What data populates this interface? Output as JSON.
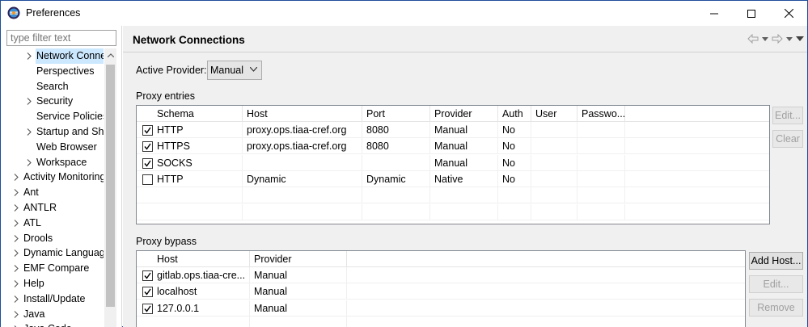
{
  "window": {
    "title": "Preferences"
  },
  "left": {
    "filter_placeholder": "type filter text",
    "tree": [
      {
        "label": "Network Conne",
        "level": 1,
        "expander": true,
        "selected": true
      },
      {
        "label": "Perspectives",
        "level": 1,
        "expander": false
      },
      {
        "label": "Search",
        "level": 1,
        "expander": false
      },
      {
        "label": "Security",
        "level": 1,
        "expander": true
      },
      {
        "label": "Service Policies",
        "level": 1,
        "expander": false
      },
      {
        "label": "Startup and Shu",
        "level": 1,
        "expander": true
      },
      {
        "label": "Web Browser",
        "level": 1,
        "expander": false
      },
      {
        "label": "Workspace",
        "level": 1,
        "expander": true
      },
      {
        "label": "Activity Monitoring",
        "level": 0,
        "expander": true
      },
      {
        "label": "Ant",
        "level": 0,
        "expander": true
      },
      {
        "label": "ANTLR",
        "level": 0,
        "expander": true
      },
      {
        "label": "ATL",
        "level": 0,
        "expander": true
      },
      {
        "label": "Drools",
        "level": 0,
        "expander": true
      },
      {
        "label": "Dynamic Languag",
        "level": 0,
        "expander": true
      },
      {
        "label": "EMF Compare",
        "level": 0,
        "expander": true
      },
      {
        "label": "Help",
        "level": 0,
        "expander": true
      },
      {
        "label": "Install/Update",
        "level": 0,
        "expander": true
      },
      {
        "label": "Java",
        "level": 0,
        "expander": true
      },
      {
        "label": "Java Code",
        "level": 0,
        "expander": true
      }
    ]
  },
  "right": {
    "title": "Network Connections",
    "active_provider_label": "Active Provider:",
    "active_provider_value": "Manual",
    "proxy_entries": {
      "label": "Proxy entries",
      "columns": [
        "Schema",
        "Host",
        "Port",
        "Provider",
        "Auth",
        "User",
        "Passwo..."
      ],
      "rows": [
        {
          "checked": true,
          "schema": "HTTP",
          "host": "proxy.ops.tiaa-cref.org",
          "port": "8080",
          "provider": "Manual",
          "auth": "No",
          "user": "",
          "password": ""
        },
        {
          "checked": true,
          "schema": "HTTPS",
          "host": "proxy.ops.tiaa-cref.org",
          "port": "8080",
          "provider": "Manual",
          "auth": "No",
          "user": "",
          "password": ""
        },
        {
          "checked": true,
          "schema": "SOCKS",
          "host": "",
          "port": "",
          "provider": "Manual",
          "auth": "No",
          "user": "",
          "password": ""
        },
        {
          "checked": false,
          "schema": "HTTP",
          "host": "Dynamic",
          "port": "Dynamic",
          "provider": "Native",
          "auth": "No",
          "user": "",
          "password": ""
        }
      ],
      "buttons": {
        "edit": "Edit...",
        "clear": "Clear"
      }
    },
    "proxy_bypass": {
      "label": "Proxy bypass",
      "columns": [
        "Host",
        "Provider"
      ],
      "rows": [
        {
          "checked": true,
          "host": "gitlab.ops.tiaa-cre...",
          "provider": "Manual"
        },
        {
          "checked": true,
          "host": "localhost",
          "provider": "Manual"
        },
        {
          "checked": true,
          "host": "127.0.0.1",
          "provider": "Manual"
        }
      ],
      "buttons": {
        "add_host": "Add Host...",
        "edit": "Edit...",
        "remove": "Remove"
      }
    }
  },
  "icons": {
    "app": "eclipse-icon",
    "minimize": "minimize-icon",
    "maximize": "maximize-icon",
    "close": "close-icon",
    "back": "back-arrow-icon",
    "forward": "forward-arrow-icon",
    "menu": "view-menu-icon"
  }
}
